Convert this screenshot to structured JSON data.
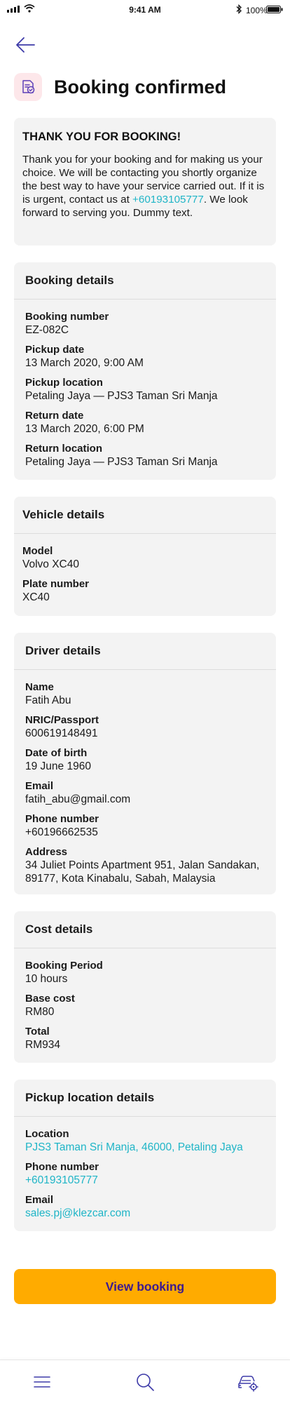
{
  "status_bar": {
    "time": "9:41 AM",
    "battery": "100%"
  },
  "icons": {
    "back": "arrow-left-icon",
    "header": "document-check-icon",
    "menu": "menu-icon",
    "search": "search-icon",
    "car_settings": "car-settings-icon"
  },
  "colors": {
    "accent": "#ffab00",
    "primary": "#3d1a8f",
    "link": "#1fb5c7",
    "card": "#f3f3f3",
    "header_icon_bg": "#fde7ea"
  },
  "title": "Booking confirmed",
  "thanks": {
    "title": "THANK YOU FOR BOOKING!",
    "text_before": "Thank you for your booking and for making us your choice. We will be contacting you shortly organize the best way to have your service carried out. If it is is urgent, contact us at ",
    "phone": "+60193105777",
    "text_after": ". We look forward to serving you. Dummy text."
  },
  "booking": {
    "title": "Booking details",
    "fields": [
      {
        "label": "Booking number",
        "value": "EZ-082C"
      },
      {
        "label": "Pickup date",
        "value": "13 March 2020, 9:00 AM"
      },
      {
        "label": "Pickup location",
        "value": "Petaling Jaya — PJS3 Taman Sri Manja"
      },
      {
        "label": "Return date",
        "value": "13 March 2020, 6:00 PM"
      },
      {
        "label": "Return location",
        "value": "Petaling Jaya — PJS3 Taman Sri Manja"
      }
    ]
  },
  "vehicle": {
    "title": "Vehicle details",
    "fields": [
      {
        "label": "Model",
        "value": "Volvo XC40"
      },
      {
        "label": "Plate number",
        "value": "XC40"
      }
    ]
  },
  "driver": {
    "title": "Driver details",
    "fields": [
      {
        "label": "Name",
        "value": "Fatih Abu"
      },
      {
        "label": "NRIC/Passport",
        "value": "600619148491"
      },
      {
        "label": "Date of birth",
        "value": "19 June 1960"
      },
      {
        "label": "Email",
        "value": "fatih_abu@gmail.com"
      },
      {
        "label": "Phone number",
        "value": "+60196662535"
      },
      {
        "label": "Address",
        "value": "34 Juliet Points Apartment 951, Jalan Sandakan, 89177, Kota Kinabalu, Sabah, Malaysia"
      }
    ]
  },
  "cost": {
    "title": "Cost details",
    "fields": [
      {
        "label": "Booking Period",
        "value": "10 hours"
      },
      {
        "label": "Base cost",
        "value": "RM80"
      },
      {
        "label": "Total",
        "value": "RM934"
      }
    ]
  },
  "pickup": {
    "title": "Pickup location details",
    "fields": [
      {
        "label": "Location",
        "value": "PJS3 Taman Sri Manja, 46000, Petaling Jaya"
      },
      {
        "label": "Phone number",
        "value": "+60193105777"
      },
      {
        "label": "Email",
        "value": "sales.pj@klezcar.com"
      }
    ]
  },
  "view_button": "View booking"
}
